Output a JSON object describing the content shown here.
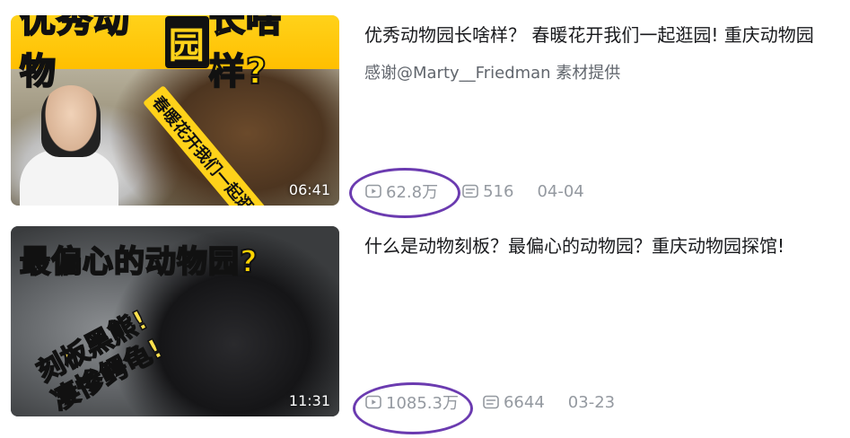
{
  "videos": [
    {
      "title": "优秀动物园长啥样？ 春暖花开我们一起逛园! 重庆动物园",
      "subtitle": "感谢@Marty__Friedman 素材提供",
      "thumb_headline_a": "优秀动物",
      "thumb_headline_b": "园",
      "thumb_headline_c": "长啥样?",
      "thumb_side_text": "春暖花开我们一起逛园",
      "duration": "06:41",
      "views": "62.8万",
      "comments": "516",
      "date": "04-04"
    },
    {
      "title": "什么是动物刻板？最偏心的动物园？重庆动物园探馆!",
      "subtitle": "",
      "thumb_headline_a": "最偏",
      "thumb_headline_b": "心",
      "thumb_headline_c": "的动物园?",
      "thumb_side_text": "刻板黑熊!\n凄惨鳄龟!",
      "duration": "11:31",
      "views": "1085.3万",
      "comments": "6644",
      "date": "03-23"
    }
  ],
  "icons": {
    "views": "play-icon",
    "comments": "danmaku-icon"
  },
  "colors": {
    "annotation_circle": "#6b3bb0",
    "stat_text": "#9499a0",
    "thumb_band": "#ffd21a"
  }
}
